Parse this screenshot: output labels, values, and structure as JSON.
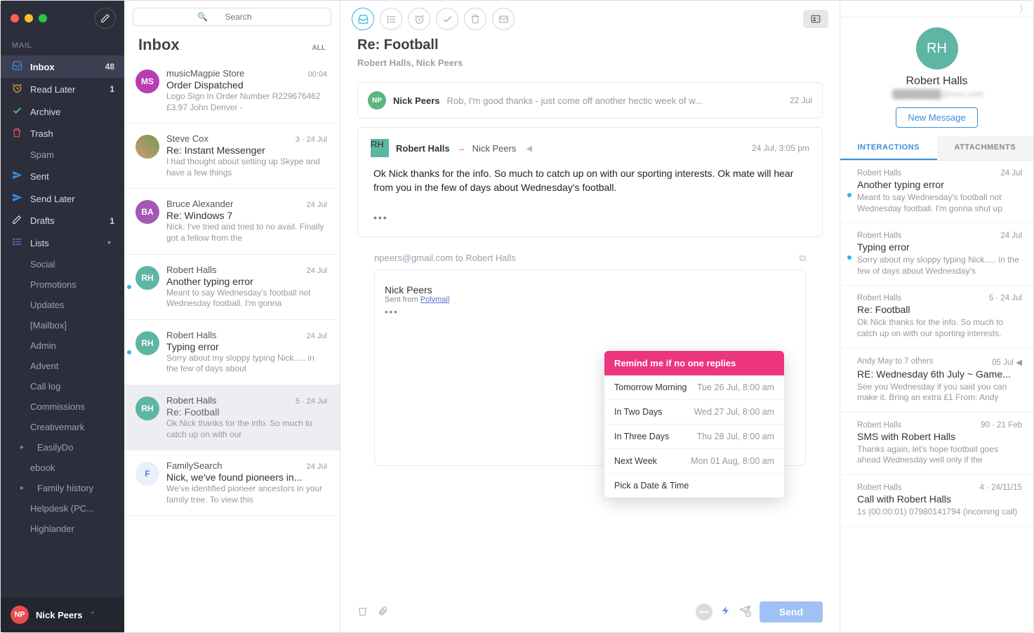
{
  "sidebar": {
    "section_label": "MAIL",
    "items": [
      {
        "icon": "inbox",
        "label": "Inbox",
        "count": "48",
        "active": true,
        "iconClass": "ic-blue"
      },
      {
        "icon": "clock",
        "label": "Read Later",
        "count": "1",
        "iconClass": "ic-orange"
      },
      {
        "icon": "check",
        "label": "Archive",
        "iconClass": "ic-green"
      },
      {
        "icon": "trash",
        "label": "Trash",
        "iconClass": "ic-red"
      },
      {
        "icon": "",
        "label": "Spam",
        "sub": true
      },
      {
        "icon": "send",
        "label": "Sent",
        "iconClass": "ic-blue"
      },
      {
        "icon": "sendlater",
        "label": "Send Later",
        "iconClass": "ic-blue"
      },
      {
        "icon": "draft",
        "label": "Drafts",
        "count": "1"
      },
      {
        "icon": "lists",
        "label": "Lists",
        "expand": "▾",
        "iconClass": "ic-purple"
      },
      {
        "label": "Social",
        "sub": true
      },
      {
        "label": "Promotions",
        "sub": true
      },
      {
        "label": "Updates",
        "sub": true
      },
      {
        "label": "[Mailbox]",
        "sub": true
      },
      {
        "label": "Admin",
        "sub": true
      },
      {
        "label": "Advent",
        "sub": true
      },
      {
        "label": "Call log",
        "sub": true
      },
      {
        "label": "Commissions",
        "sub": true
      },
      {
        "label": "Creativemark",
        "sub": true
      },
      {
        "label": "EasilyDo",
        "sub": true,
        "chevron": true
      },
      {
        "label": "ebook",
        "sub": true
      },
      {
        "label": "Family history",
        "sub": true,
        "chevron": true
      },
      {
        "label": "Helpdesk (PC...",
        "sub": true
      },
      {
        "label": "Highlander",
        "sub": true
      }
    ],
    "footer_initials": "NP",
    "footer_name": "Nick Peers"
  },
  "search": {
    "placeholder": "Search"
  },
  "list": {
    "title": "Inbox",
    "all": "ALL",
    "messages": [
      {
        "sender": "musicMagpie Store",
        "subject": "Order Dispatched",
        "preview": "Logo Sign In Order Number R229676462 £3.97 John Denver -",
        "meta": "00:04",
        "avatar": "MS",
        "avatarClass": "c-magenta"
      },
      {
        "sender": "Steve Cox",
        "subject": "Re: Instant Messenger",
        "preview": "I had thought about setting up Skype and have a few things",
        "meta": "3  ·  24 Jul",
        "avatar": "",
        "avatarClass": "c-img"
      },
      {
        "sender": "Bruce Alexander",
        "subject": "Re: Windows 7",
        "preview": "Nick. I've tried and tried to no avail. Finally got a fellow from the",
        "meta": "24 Jul",
        "avatar": "BA",
        "avatarClass": "c-purple"
      },
      {
        "sender": "Robert Halls",
        "subject": "Another typing error",
        "preview": "Meant to say Wednesday's football not Wednesday football. I'm gonna",
        "meta": "24 Jul",
        "avatar": "RH",
        "avatarClass": "c-teal",
        "unread": true
      },
      {
        "sender": "Robert Halls",
        "subject": "Typing error",
        "preview": "Sorry about my sloppy typing Nick..... in the few of days about",
        "meta": "24 Jul",
        "avatar": "RH",
        "avatarClass": "c-teal",
        "unread": true
      },
      {
        "sender": "Robert Halls",
        "subject": "Re: Football",
        "preview": "Ok Nick thanks for the info. So much to catch up on with our",
        "meta": "5  ·  24 Jul",
        "avatar": "RH",
        "avatarClass": "c-teal",
        "selected": true
      },
      {
        "sender": "FamilySearch",
        "subject": "Nick, we've found pioneers in...",
        "preview": "We've identified pioneer ancestors in your family tree. To view this",
        "meta": "24 Jul",
        "avatar": "F",
        "avatarClass": "c-blue"
      }
    ]
  },
  "reader": {
    "subject": "Re: Football",
    "participants": "Robert Halls, Nick Peers",
    "collapsed": {
      "avatar": "NP",
      "avatarClass": "c-green",
      "sender": "Nick Peers",
      "preview": "Rob, I'm good thanks - just come off another hectic week of w...",
      "date": "22 Jul"
    },
    "expanded": {
      "avatar": "RH",
      "avatarClass": "c-teal",
      "sender": "Robert Halls",
      "recipient": "Nick Peers",
      "date": "24 Jul, 3:05 pm",
      "body": "Ok Nick thanks for the info. So much to catch up on with our sporting interests. Ok mate will hear from you in the few of days about Wednesday's football."
    },
    "reply": {
      "address_line": "npeers@gmail.com to Robert Halls",
      "sig_name": "Nick Peers",
      "sig_from_prefix": "Sent from ",
      "sig_from_link": "Polymail"
    },
    "remind": {
      "header": "Remind me if no one replies",
      "rows": [
        {
          "label": "Tomorrow Morning",
          "date": "Tue 26 Jul, 8:00 am"
        },
        {
          "label": "In Two Days",
          "date": "Wed 27 Jul, 8:00 am"
        },
        {
          "label": "In Three Days",
          "date": "Thu 28 Jul, 8:00 am"
        },
        {
          "label": "Next Week",
          "date": "Mon 01 Aug, 8:00 am"
        },
        {
          "label": "Pick a Date & Time",
          "date": ""
        }
      ]
    },
    "send_label": "Send"
  },
  "contact": {
    "avatar": "RH",
    "name": "Robert Halls",
    "email": "r████████@msn.com",
    "new_message": "New Message",
    "tabs": {
      "interactions": "INTERACTIONS",
      "attachments": "ATTACHMENTS"
    },
    "items": [
      {
        "sender": "Robert Halls",
        "meta": "24 Jul",
        "subject": "Another typing error",
        "preview": "Meant to say Wednesday's football not Wednesday football. I'm gonna shut up",
        "unread": true
      },
      {
        "sender": "Robert Halls",
        "meta": "24 Jul",
        "subject": "Typing error",
        "preview": "Sorry about my sloppy typing Nick..... in the few of days about Wednesday's",
        "unread": true
      },
      {
        "sender": "Robert Halls",
        "meta": "5  ·  24 Jul",
        "subject": "Re: Football",
        "preview": "Ok Nick thanks for the info. So much to catch up on with our sporting interests."
      },
      {
        "sender": "Andy May to 7 others",
        "meta": "05 Jul ◀",
        "subject": "RE: Wednesday 6th July ~ Game...",
        "preview": "See you Wednesday if you said you can make it. Bring an extra £1 From: Andy"
      },
      {
        "sender": "Robert Halls",
        "meta": "90  ·  21 Feb",
        "subject": "SMS with Robert Halls",
        "preview": "Thanks again, let's hope football goes ahead Wednesday well only if the"
      },
      {
        "sender": "Robert Halls",
        "meta": "4  ·  24/11/15",
        "subject": "Call with Robert Halls",
        "preview": "1s (00:00:01) 07980141794 (incoming call)"
      }
    ]
  }
}
